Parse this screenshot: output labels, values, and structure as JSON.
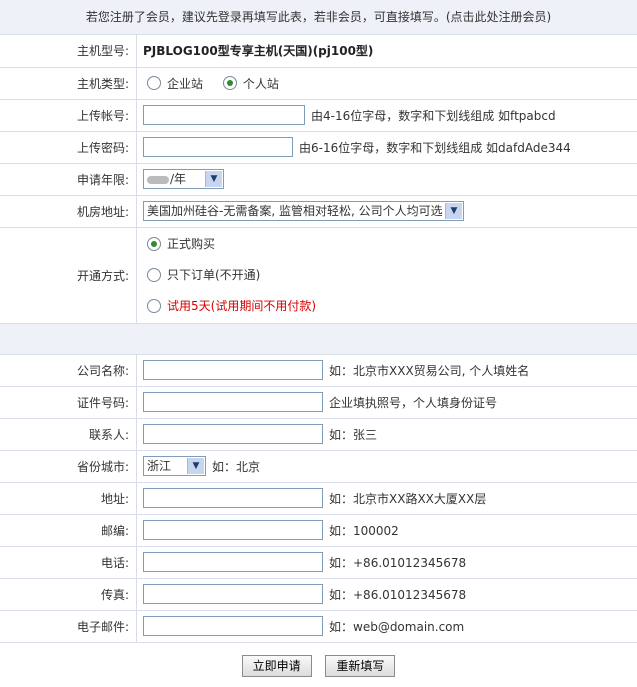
{
  "notice": "若您注册了会员，建议先登录再填写此表，若非会员，可直接填写。(点击此处注册会员)",
  "labels": {
    "host_model": "主机型号:",
    "host_type": "主机类型:",
    "upload_account": "上传帐号:",
    "upload_password": "上传密码:",
    "apply_years": "申请年限:",
    "room_address": "机房地址:",
    "open_method": "开通方式:",
    "company_name": "公司名称:",
    "id_number": "证件号码:",
    "contact": "联系人:",
    "province_city": "省份城市:",
    "address": "地址:",
    "postcode": "邮编:",
    "phone": "电话:",
    "fax": "传真:",
    "email": "电子邮件:"
  },
  "values": {
    "host_model": "PJBLOG100型专享主机(天国)(pj100型)",
    "host_type_options": [
      "企业站",
      "个人站"
    ],
    "host_type_selected": "个人站",
    "apply_years_unit": "/年",
    "room_address": "美国加州硅谷-无需备案, 监管相对轻松, 公司个人均可选",
    "open_options": [
      {
        "label": "正式购买",
        "selected": true,
        "red": false
      },
      {
        "label": "只下订单(不开通)",
        "selected": false,
        "red": false
      },
      {
        "label": "试用5天(试用期间不用付款)",
        "selected": false,
        "red": true
      }
    ],
    "province": "浙江"
  },
  "hints": {
    "upload_account": "由4-16位字母，数字和下划线组成 如ftpabcd",
    "upload_password": "由6-16位字母，数字和下划线组成 如dafdAde344",
    "company_name": "如：北京市XXX贸易公司, 个人填姓名",
    "id_number": "企业填执照号，个人填身份证号",
    "contact": "如：张三",
    "province_city": "如：北京",
    "address": "如：北京市XX路XX大厦XX层",
    "postcode": "如：100002",
    "phone": "如：+86.01012345678",
    "fax": "如：+86.01012345678",
    "email": "如：web@domain.com"
  },
  "buttons": {
    "submit": "立即申请",
    "reset": "重新填写"
  }
}
